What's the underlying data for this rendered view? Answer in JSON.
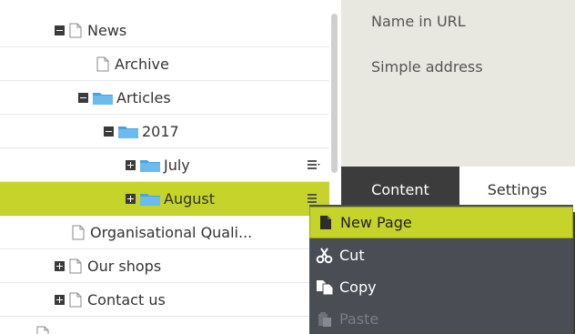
{
  "tree": {
    "nodes": [
      {
        "label": "News",
        "toggle": "minus",
        "icon": "page",
        "selected": false
      },
      {
        "label": "Archive",
        "toggle": "",
        "icon": "page",
        "selected": false
      },
      {
        "label": "Articles",
        "toggle": "minus",
        "icon": "folder",
        "selected": false
      },
      {
        "label": "2017",
        "toggle": "minus",
        "icon": "folder",
        "selected": false
      },
      {
        "label": "July",
        "toggle": "plus",
        "icon": "folder",
        "selected": false
      },
      {
        "label": "August",
        "toggle": "plus",
        "icon": "folder",
        "selected": true
      },
      {
        "label": "Organisational Quali...",
        "toggle": "",
        "icon": "page",
        "selected": false
      },
      {
        "label": "Our shops",
        "toggle": "plus",
        "icon": "page",
        "selected": false
      },
      {
        "label": "Contact us",
        "toggle": "plus",
        "icon": "page",
        "selected": false
      }
    ]
  },
  "properties": {
    "name_in_url_label": "Name in URL",
    "simple_address_label": "Simple address"
  },
  "tabs": {
    "content_label": "Content",
    "settings_label": "Settings"
  },
  "context_menu": {
    "items": [
      {
        "label": "New Page",
        "icon": "new-page-icon",
        "highlighted": true,
        "disabled": false
      },
      {
        "label": "Cut",
        "icon": "scissors-icon",
        "highlighted": false,
        "disabled": false
      },
      {
        "label": "Copy",
        "icon": "copy-icon",
        "highlighted": false,
        "disabled": false
      },
      {
        "label": "Paste",
        "icon": "paste-icon",
        "highlighted": false,
        "disabled": true
      }
    ]
  },
  "colors": {
    "selection": "#c6d32a",
    "menu_background": "#4a4e54",
    "properties_background": "#e8e8e1",
    "folder": "#4aa3df"
  }
}
